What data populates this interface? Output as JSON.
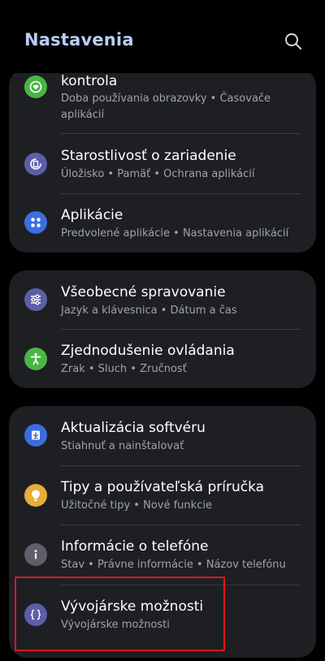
{
  "header": {
    "title": "Nastavenia",
    "search_icon": "search-icon"
  },
  "colors": {
    "background": "#000000",
    "card": "#1d1f23",
    "title": "#b9cdf8",
    "highlight": "#e0161b"
  },
  "groups": [
    {
      "items": [
        {
          "id": "digital-wellbeing",
          "label": "kontrola",
          "sub_line1": "Doba používania obrazovky  •  Časovače",
          "sub_line2": "aplikácií",
          "icon": "heart-icon",
          "icon_color": "#4ab544"
        },
        {
          "id": "device-care",
          "label": "Starostlivosť o zariadenie",
          "sub": "Úložisko  •  Pamäť  •  Ochrana aplikácií",
          "icon": "device-care-icon",
          "icon_color": "#5c5fa8"
        },
        {
          "id": "apps",
          "label": "Aplikácie",
          "sub": "Predvolené aplikácie  •  Nastavenia aplikácií",
          "icon": "apps-grid-icon",
          "icon_color": "#3c6de0"
        }
      ]
    },
    {
      "items": [
        {
          "id": "general-management",
          "label": "Všeobecné spravovanie",
          "sub": "Jazyk a klávesnica  •  Dátum a čas",
          "icon": "sliders-icon",
          "icon_color": "#5c5fa8"
        },
        {
          "id": "accessibility",
          "label": "Zjednodušenie ovládania",
          "sub": "Zrak  •  Sluch  •  Zručnosť",
          "icon": "accessibility-icon",
          "icon_color": "#4ab544"
        }
      ]
    },
    {
      "items": [
        {
          "id": "software-update",
          "label": "Aktualizácia softvéru",
          "sub": "Stiahnuť a nainštalovať",
          "icon": "software-update-icon",
          "icon_color": "#3c6de0"
        },
        {
          "id": "tips",
          "label": "Tipy a používateľská príručka",
          "sub": "Užitočné tipy  •  Nové funkcie",
          "icon": "lightbulb-icon",
          "icon_color": "#e8ad3a"
        },
        {
          "id": "about-phone",
          "label": "Informácie o telefóne",
          "sub": "Stav  •  Právne informácie  •  Názov telefónu",
          "icon": "info-icon",
          "icon_color": "#5e5f6a"
        },
        {
          "id": "developer-options",
          "label": "Vývojárske možnosti",
          "sub": "Vývojárske možnosti",
          "icon": "braces-icon",
          "icon_color": "#5c5fa8"
        }
      ]
    }
  ]
}
